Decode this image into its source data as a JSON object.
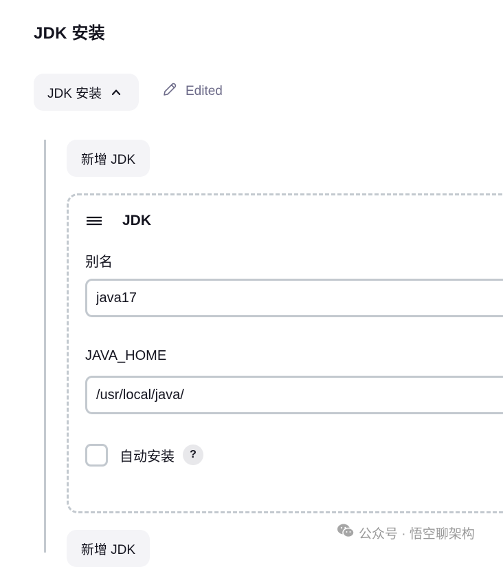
{
  "page": {
    "title": "JDK 安装"
  },
  "section": {
    "toggle_label": "JDK 安装",
    "toggle_icon": "chevron-up-icon",
    "edited_label": "Edited",
    "edited_icon": "pencil-icon"
  },
  "buttons": {
    "add_jdk_label": "新增 JDK"
  },
  "jdk_item": {
    "header_icon": "drag-handle-icon",
    "header_title": "JDK",
    "name_label": "别名",
    "name_value": "java17",
    "java_home_label": "JAVA_HOME",
    "java_home_value": "/usr/local/java/",
    "auto_install_label": "自动安装",
    "auto_install_checked": false,
    "help_label": "?"
  },
  "watermark": {
    "icon": "wechat-icon",
    "text": "公众号 · 悟空聊架构"
  },
  "colors": {
    "text": "#14141f",
    "muted": "#6d6b89",
    "border": "#c3c9cf",
    "button_bg": "#f4f4f7"
  }
}
